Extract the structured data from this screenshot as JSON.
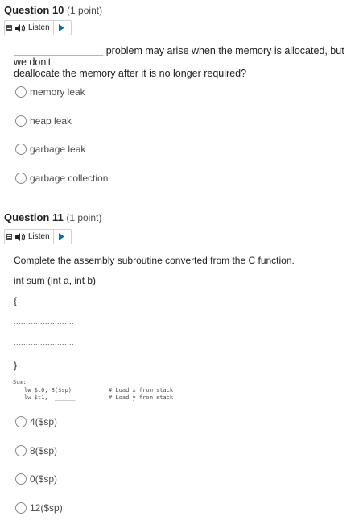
{
  "q10": {
    "title": "Question 10",
    "points": "(1 point)",
    "listen_label": "Listen",
    "blank": "________________",
    "prompt_line1": "problem may arise when the memory is allocated, but we don't",
    "prompt_line2": "deallocate the memory after it is no longer required?",
    "options": [
      "memory leak",
      "heap leak",
      "garbage leak",
      "garbage collection"
    ]
  },
  "q11": {
    "title": "Question 11",
    "points": "(1 point)",
    "listen_label": "Listen",
    "line1": "Complete the assembly subroutine converted from the C function.",
    "line2": "int sum (int a, int b)",
    "open_brace": "{",
    "dots1": ".........................",
    "dots2": ".........................",
    "close_brace": "}",
    "code": {
      "label": "Sum:",
      "instr1": "lw $t0, 8($sp)",
      "instr2": "lw $t1,",
      "blank": "______",
      "comment1": "# Load x from stack",
      "comment2": "# Load y from stack"
    },
    "options": [
      "4($sp)",
      "8($sp)",
      "0($sp)",
      "12($sp)"
    ]
  }
}
